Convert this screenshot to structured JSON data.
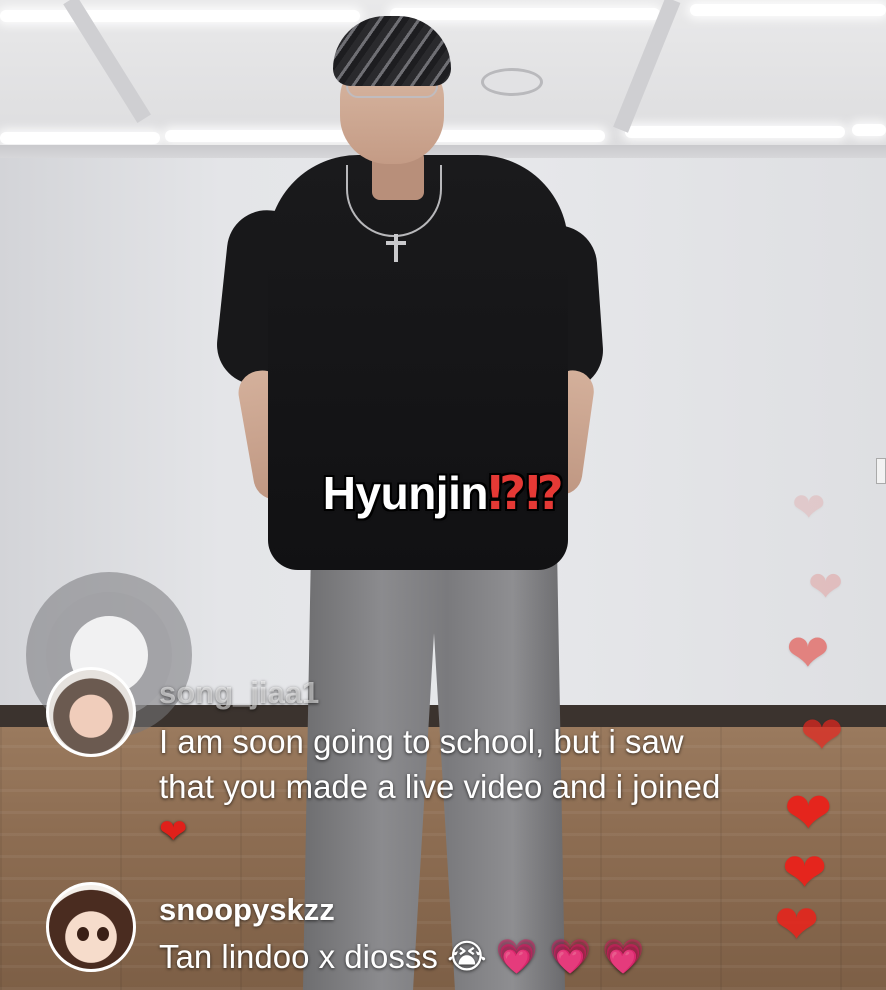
{
  "overlay": {
    "headline_name": "Hyunjin",
    "headline_marks": "⁉⁉"
  },
  "comments": [
    {
      "username": "song_jiaa1",
      "message": "I am soon going to school, but i saw that you made a live video and i joined",
      "emoji": "❤"
    },
    {
      "username": "snoopyskzz",
      "message": "Tan lindoo x diosss",
      "emoji_cry": "😭",
      "emoji_hearts": "💗 💗 💗"
    }
  ],
  "floating_heart_glyph": "❤",
  "colors": {
    "heart_red": "#e5251d",
    "headline_mark": "#e53935",
    "pink_heart": "#e0569f"
  },
  "icons": [
    "touch-indicator-icon",
    "heart-icon"
  ]
}
